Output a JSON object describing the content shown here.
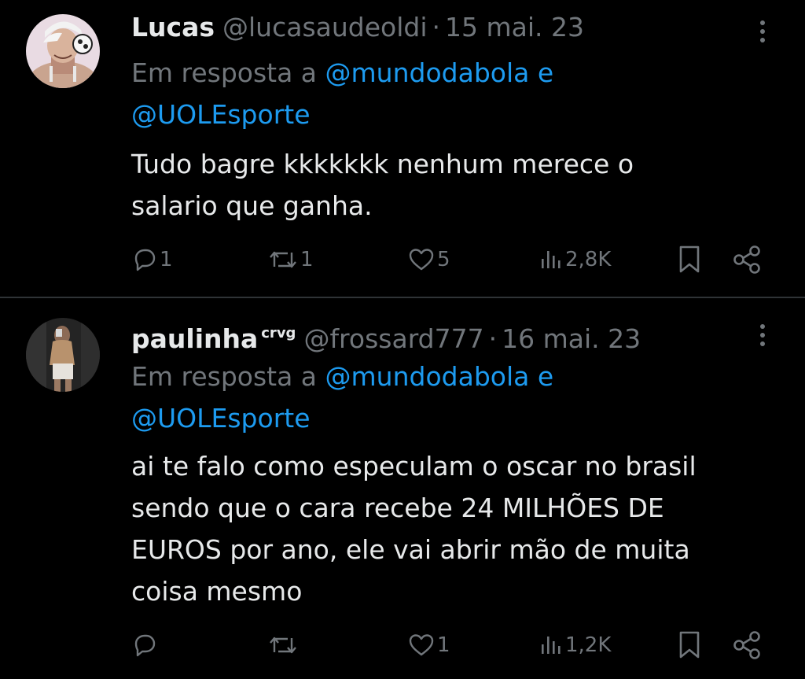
{
  "tweets": [
    {
      "name": "Lucas",
      "badge": "",
      "handle": "@lucasaudeoldi",
      "separator": "·",
      "date": "15 mai. 23",
      "reply_prefix": "Em resposta a",
      "reply_mention_1": "@mundodabola",
      "reply_conj": "e",
      "reply_mention_2": "@UOLEsporte",
      "text": "Tudo bagre kkkkkkk nenhum merece o\nsalario que ganha.",
      "replies": "1",
      "retweets": "1",
      "likes": "5",
      "views": "2,8K"
    },
    {
      "name": "paulinha",
      "badge": "crvg",
      "handle": "@frossard777",
      "separator": "·",
      "date": "16 mai. 23",
      "reply_prefix": "Em resposta a",
      "reply_mention_1": "@mundodabola",
      "reply_conj": "e",
      "reply_mention_2": "@UOLEsporte",
      "text": "ai te falo como especulam o oscar no brasil\nsendo que o cara recebe 24 MILHÕES DE\nEUROS por ano, ele vai abrir mão de muita\ncoisa mesmo",
      "replies": "",
      "retweets": "",
      "likes": "1",
      "views": "1,2K"
    }
  ],
  "icons": {
    "more": "more-vertical-icon",
    "reply": "reply-bubble-icon",
    "retweet": "retweet-icon",
    "like": "heart-icon",
    "views": "views-bars-icon",
    "bookmark": "bookmark-icon",
    "share": "share-icon"
  },
  "colors": {
    "background": "#000000",
    "text": "#e7e9ea",
    "muted": "#71767b",
    "link": "#1d9bf0",
    "divider": "#2f3336"
  }
}
